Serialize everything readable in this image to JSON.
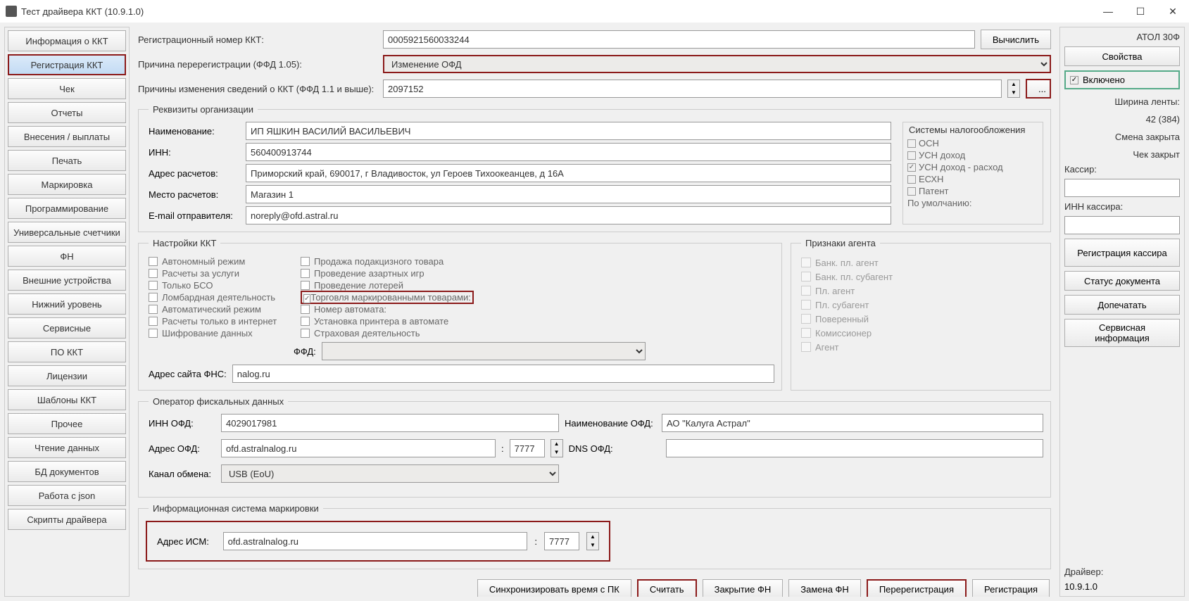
{
  "title": "Тест драйвера ККТ (10.9.1.0)",
  "nav": {
    "items": [
      "Информация о ККТ",
      "Регистрация ККТ",
      "Чек",
      "Отчеты",
      "Внесения / выплаты",
      "Печать",
      "Маркировка",
      "Программирование",
      "Универсальные счетчики",
      "ФН",
      "Внешние устройства",
      "Нижний уровень",
      "Сервисные",
      "ПО ККТ",
      "Лицензии",
      "Шаблоны ККТ",
      "Прочее",
      "Чтение данных",
      "БД документов",
      "Работа с json",
      "Скрипты драйвера"
    ],
    "active_index": 1
  },
  "fields": {
    "reg_num_label": "Регистрационный номер ККТ:",
    "reg_num_value": "0005921560033244",
    "calc_btn": "Вычислить",
    "rereg_reason_label": "Причина перерегистрации (ФФД 1.05):",
    "rereg_reason_value": "Изменение ОФД",
    "change_reasons_label": "Причины изменения сведений о ККТ (ФФД 1.1 и выше):",
    "change_reasons_value": "2097152",
    "dots": "..."
  },
  "org": {
    "legend": "Реквизиты организации",
    "name_label": "Наименование:",
    "name_value": "ИП ЯШКИН ВАСИЛИЙ ВАСИЛЬЕВИЧ",
    "inn_label": "ИНН:",
    "inn_value": "560400913744",
    "addr_label": "Адрес расчетов:",
    "addr_value": "Приморский край, 690017, г Владивосток, ул Героев Тихоокеанцев, д 16А",
    "place_label": "Место расчетов:",
    "place_value": "Магазин 1",
    "email_label": "E-mail отправителя:",
    "email_value": "noreply@ofd.astral.ru"
  },
  "tax": {
    "title": "Системы налогообложения",
    "items": [
      "ОСН",
      "УСН доход",
      "УСН доход - расход",
      "ЕСХН",
      "Патент"
    ],
    "checked_index": 2,
    "default_label": "По умолчанию:"
  },
  "kkt": {
    "legend": "Настройки ККТ",
    "col1": [
      "Автономный режим",
      "Расчеты за услуги",
      "Только БСО",
      "Ломбардная деятельность",
      "Автоматический режим",
      "Расчеты только в интернет",
      "Шифрование данных"
    ],
    "col2": [
      "Продажа подакцизного товара",
      "Проведение азартных игр",
      "Проведение лотерей",
      "Торговля маркированными товарами:",
      "Номер автомата:",
      "Установка принтера в автомате",
      "Страховая деятельность"
    ],
    "ffd_label": "ФФД:",
    "fns_label": "Адрес сайта ФНС:",
    "fns_value": "nalog.ru"
  },
  "agent": {
    "legend": "Признаки агента",
    "items": [
      "Банк. пл. агент",
      "Банк. пл. субагент",
      "Пл. агент",
      "Пл. субагент",
      "Поверенный",
      "Комиссионер",
      "Агент"
    ]
  },
  "ofd": {
    "legend": "Оператор фискальных данных",
    "inn_label": "ИНН ОФД:",
    "inn_value": "4029017981",
    "name_label": "Наименование ОФД:",
    "name_value": "АО \"Калуга Астрал\"",
    "addr_label": "Адрес ОФД:",
    "addr_value": "ofd.astralnalog.ru",
    "port_value": "7777",
    "dns_label": "DNS ОФД:",
    "dns_value": "",
    "channel_label": "Канал обмена:",
    "channel_value": "USB (EoU)",
    "colon": ":"
  },
  "ism": {
    "legend": "Информационная система маркировки",
    "addr_label": "Адрес ИСМ:",
    "addr_value": "ofd.astralnalog.ru",
    "port_value": "7777",
    "colon": ":"
  },
  "bottom": {
    "sync": "Синхронизировать время с ПК",
    "read": "Считать",
    "close_fn": "Закрытие ФН",
    "replace_fn": "Замена ФН",
    "rereg": "Перерегистрация",
    "reg": "Регистрация"
  },
  "right": {
    "device": "АТОЛ 30Ф",
    "props_btn": "Свойства",
    "enabled_label": "Включено",
    "tape_label": "Ширина ленты:",
    "tape_value": "42 (384)",
    "shift_label": "Смена закрыта",
    "check_label": "Чек закрыт",
    "cashier_label": "Кассир:",
    "cashier_inn_label": "ИНН кассира:",
    "reg_cashier_btn": "Регистрация кассира",
    "doc_status_btn": "Статус документа",
    "reprint_btn": "Допечатать",
    "service_btn": "Сервисная информация",
    "driver_label": "Драйвер:",
    "driver_value": "10.9.1.0"
  }
}
